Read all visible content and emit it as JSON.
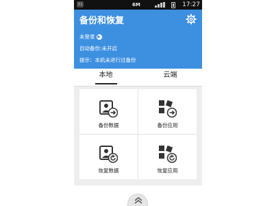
{
  "status_bar": {
    "left_badge": "31",
    "network": "6M",
    "time": "17:27"
  },
  "header": {
    "title": "备份和恢复",
    "login_text": "未登录",
    "auto_backup": "自动备份:未开启",
    "tip": "提示：本机未进行过备份"
  },
  "tabs": [
    {
      "label": "本地",
      "active": true
    },
    {
      "label": "云端",
      "active": false
    }
  ],
  "actions": [
    {
      "label": "备份数据",
      "icon": "backup-data-icon"
    },
    {
      "label": "备份应用",
      "icon": "backup-apps-icon"
    },
    {
      "label": "恢复数据",
      "icon": "restore-data-icon"
    },
    {
      "label": "恢复应用",
      "icon": "restore-apps-icon"
    }
  ],
  "colors": {
    "accent": "#3d8fe0",
    "background": "#eeeeee"
  }
}
